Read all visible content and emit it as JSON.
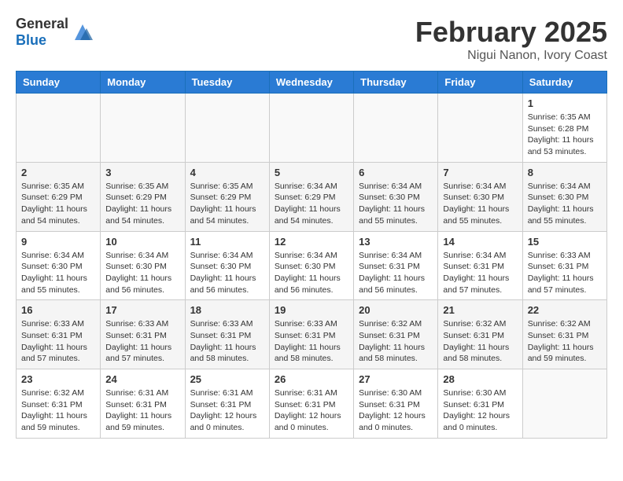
{
  "header": {
    "logo_general": "General",
    "logo_blue": "Blue",
    "month_title": "February 2025",
    "location": "Nigui Nanon, Ivory Coast"
  },
  "days_of_week": [
    "Sunday",
    "Monday",
    "Tuesday",
    "Wednesday",
    "Thursday",
    "Friday",
    "Saturday"
  ],
  "weeks": [
    [
      {
        "day": "",
        "info": ""
      },
      {
        "day": "",
        "info": ""
      },
      {
        "day": "",
        "info": ""
      },
      {
        "day": "",
        "info": ""
      },
      {
        "day": "",
        "info": ""
      },
      {
        "day": "",
        "info": ""
      },
      {
        "day": "1",
        "info": "Sunrise: 6:35 AM\nSunset: 6:28 PM\nDaylight: 11 hours\nand 53 minutes."
      }
    ],
    [
      {
        "day": "2",
        "info": "Sunrise: 6:35 AM\nSunset: 6:29 PM\nDaylight: 11 hours\nand 54 minutes."
      },
      {
        "day": "3",
        "info": "Sunrise: 6:35 AM\nSunset: 6:29 PM\nDaylight: 11 hours\nand 54 minutes."
      },
      {
        "day": "4",
        "info": "Sunrise: 6:35 AM\nSunset: 6:29 PM\nDaylight: 11 hours\nand 54 minutes."
      },
      {
        "day": "5",
        "info": "Sunrise: 6:34 AM\nSunset: 6:29 PM\nDaylight: 11 hours\nand 54 minutes."
      },
      {
        "day": "6",
        "info": "Sunrise: 6:34 AM\nSunset: 6:30 PM\nDaylight: 11 hours\nand 55 minutes."
      },
      {
        "day": "7",
        "info": "Sunrise: 6:34 AM\nSunset: 6:30 PM\nDaylight: 11 hours\nand 55 minutes."
      },
      {
        "day": "8",
        "info": "Sunrise: 6:34 AM\nSunset: 6:30 PM\nDaylight: 11 hours\nand 55 minutes."
      }
    ],
    [
      {
        "day": "9",
        "info": "Sunrise: 6:34 AM\nSunset: 6:30 PM\nDaylight: 11 hours\nand 55 minutes."
      },
      {
        "day": "10",
        "info": "Sunrise: 6:34 AM\nSunset: 6:30 PM\nDaylight: 11 hours\nand 56 minutes."
      },
      {
        "day": "11",
        "info": "Sunrise: 6:34 AM\nSunset: 6:30 PM\nDaylight: 11 hours\nand 56 minutes."
      },
      {
        "day": "12",
        "info": "Sunrise: 6:34 AM\nSunset: 6:30 PM\nDaylight: 11 hours\nand 56 minutes."
      },
      {
        "day": "13",
        "info": "Sunrise: 6:34 AM\nSunset: 6:31 PM\nDaylight: 11 hours\nand 56 minutes."
      },
      {
        "day": "14",
        "info": "Sunrise: 6:34 AM\nSunset: 6:31 PM\nDaylight: 11 hours\nand 57 minutes."
      },
      {
        "day": "15",
        "info": "Sunrise: 6:33 AM\nSunset: 6:31 PM\nDaylight: 11 hours\nand 57 minutes."
      }
    ],
    [
      {
        "day": "16",
        "info": "Sunrise: 6:33 AM\nSunset: 6:31 PM\nDaylight: 11 hours\nand 57 minutes."
      },
      {
        "day": "17",
        "info": "Sunrise: 6:33 AM\nSunset: 6:31 PM\nDaylight: 11 hours\nand 57 minutes."
      },
      {
        "day": "18",
        "info": "Sunrise: 6:33 AM\nSunset: 6:31 PM\nDaylight: 11 hours\nand 58 minutes."
      },
      {
        "day": "19",
        "info": "Sunrise: 6:33 AM\nSunset: 6:31 PM\nDaylight: 11 hours\nand 58 minutes."
      },
      {
        "day": "20",
        "info": "Sunrise: 6:32 AM\nSunset: 6:31 PM\nDaylight: 11 hours\nand 58 minutes."
      },
      {
        "day": "21",
        "info": "Sunrise: 6:32 AM\nSunset: 6:31 PM\nDaylight: 11 hours\nand 58 minutes."
      },
      {
        "day": "22",
        "info": "Sunrise: 6:32 AM\nSunset: 6:31 PM\nDaylight: 11 hours\nand 59 minutes."
      }
    ],
    [
      {
        "day": "23",
        "info": "Sunrise: 6:32 AM\nSunset: 6:31 PM\nDaylight: 11 hours\nand 59 minutes."
      },
      {
        "day": "24",
        "info": "Sunrise: 6:31 AM\nSunset: 6:31 PM\nDaylight: 11 hours\nand 59 minutes."
      },
      {
        "day": "25",
        "info": "Sunrise: 6:31 AM\nSunset: 6:31 PM\nDaylight: 12 hours\nand 0 minutes."
      },
      {
        "day": "26",
        "info": "Sunrise: 6:31 AM\nSunset: 6:31 PM\nDaylight: 12 hours\nand 0 minutes."
      },
      {
        "day": "27",
        "info": "Sunrise: 6:30 AM\nSunset: 6:31 PM\nDaylight: 12 hours\nand 0 minutes."
      },
      {
        "day": "28",
        "info": "Sunrise: 6:30 AM\nSunset: 6:31 PM\nDaylight: 12 hours\nand 0 minutes."
      },
      {
        "day": "",
        "info": ""
      }
    ]
  ]
}
